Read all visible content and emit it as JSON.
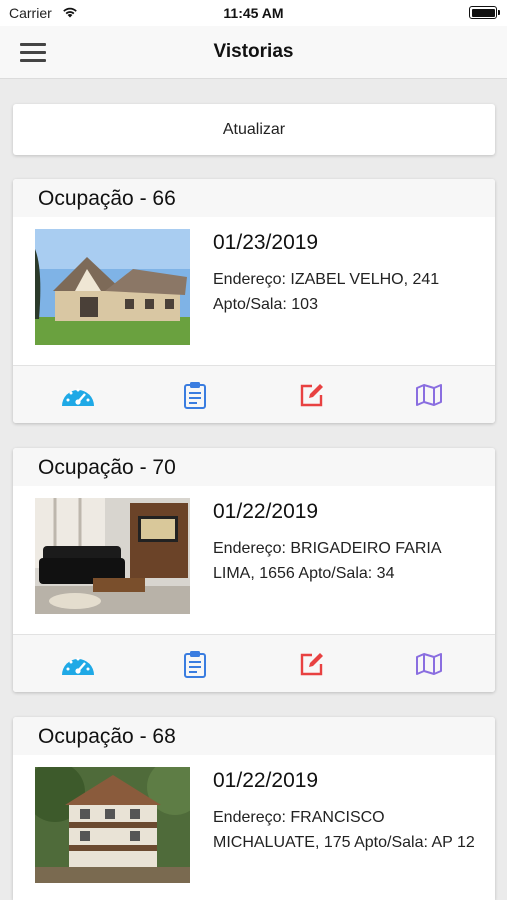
{
  "status_bar": {
    "carrier": "Carrier",
    "time": "11:45 AM"
  },
  "nav": {
    "title": "Vistorias"
  },
  "refresh": {
    "label": "Atualizar"
  },
  "cards": [
    {
      "title": "Ocupação - 66",
      "date": "01/23/2019",
      "address": "Endereço: IZABEL VELHO, 241 Apto/Sala: 103"
    },
    {
      "title": "Ocupação - 70",
      "date": "01/22/2019",
      "address": "Endereço: BRIGADEIRO FARIA LIMA, 1656 Apto/Sala: 34"
    },
    {
      "title": "Ocupação - 68",
      "date": "01/22/2019",
      "address": "Endereço: FRANCISCO MICHALUATE, 175 Apto/Sala: AP 12"
    }
  ],
  "action_icons": [
    "dashboard-gauge-icon",
    "clipboard-icon",
    "edit-icon",
    "map-icon"
  ],
  "colors": {
    "gauge": "#1fa9e6",
    "clipboard": "#3a7de0",
    "edit": "#e84141",
    "map": "#8a6ee0"
  }
}
